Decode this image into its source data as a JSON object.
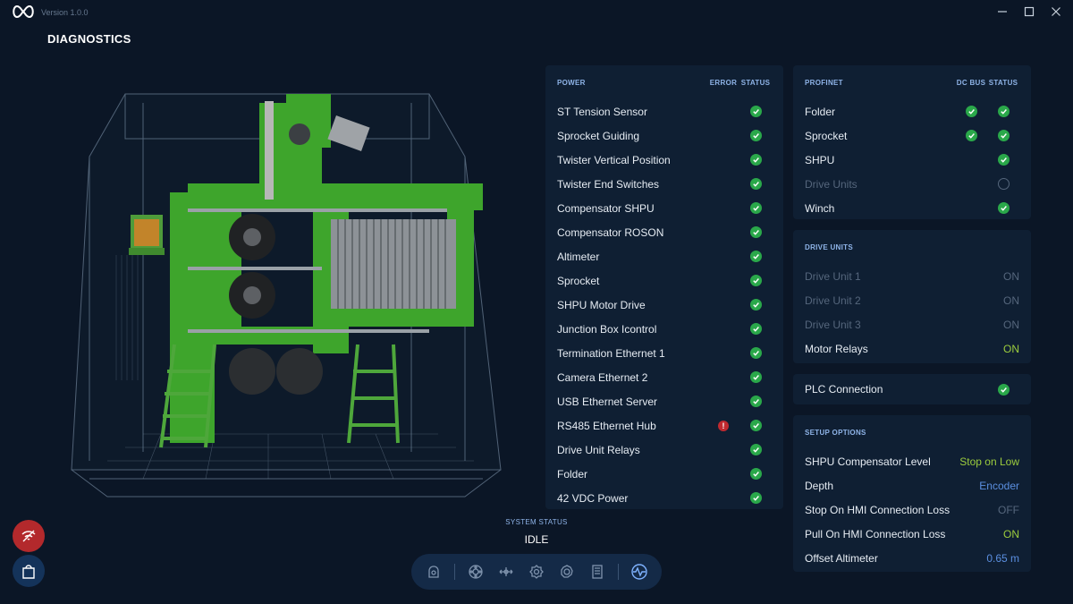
{
  "app": {
    "version": "Version 1.0.0"
  },
  "page": {
    "title": "DIAGNOSTICS"
  },
  "power": {
    "title": "POWER",
    "col_error": "ERROR",
    "col_status": "STATUS",
    "rows": [
      {
        "label": "ST Tension Sensor",
        "error": false,
        "status": "ok"
      },
      {
        "label": "Sprocket Guiding",
        "error": false,
        "status": "ok"
      },
      {
        "label": "Twister Vertical Position",
        "error": false,
        "status": "ok"
      },
      {
        "label": "Twister End Switches",
        "error": false,
        "status": "ok"
      },
      {
        "label": "Compensator SHPU",
        "error": false,
        "status": "ok"
      },
      {
        "label": "Compensator ROSON",
        "error": false,
        "status": "ok"
      },
      {
        "label": "Altimeter",
        "error": false,
        "status": "ok"
      },
      {
        "label": "Sprocket",
        "error": false,
        "status": "ok"
      },
      {
        "label": "SHPU Motor Drive",
        "error": false,
        "status": "ok"
      },
      {
        "label": "Junction Box Icontrol",
        "error": false,
        "status": "ok"
      },
      {
        "label": "Termination Ethernet 1",
        "error": false,
        "status": "ok"
      },
      {
        "label": "Camera Ethernet 2",
        "error": false,
        "status": "ok"
      },
      {
        "label": "USB Ethernet Server",
        "error": false,
        "status": "ok"
      },
      {
        "label": "RS485 Ethernet Hub",
        "error": true,
        "status": "ok"
      },
      {
        "label": "Drive Unit Relays",
        "error": false,
        "status": "ok"
      },
      {
        "label": "Folder",
        "error": false,
        "status": "ok"
      },
      {
        "label": "42 VDC Power",
        "error": false,
        "status": "ok"
      }
    ]
  },
  "profinet": {
    "title": "PROFINET",
    "col_dcbus": "DC BUS",
    "col_status": "STATUS",
    "rows": [
      {
        "label": "Folder",
        "dcbus": "ok",
        "status": "ok",
        "disabled": false
      },
      {
        "label": "Sprocket",
        "dcbus": "ok",
        "status": "ok",
        "disabled": false
      },
      {
        "label": "SHPU",
        "dcbus": "none",
        "status": "ok",
        "disabled": false
      },
      {
        "label": "Drive Units",
        "dcbus": "none",
        "status": "empty",
        "disabled": true
      },
      {
        "label": "Winch",
        "dcbus": "none",
        "status": "ok",
        "disabled": false
      }
    ]
  },
  "drive_units": {
    "title": "DRIVE UNITS",
    "rows": [
      {
        "label": "Drive Unit 1",
        "value": "ON",
        "color": "#55667c",
        "disabled": true
      },
      {
        "label": "Drive Unit 2",
        "value": "ON",
        "color": "#55667c",
        "disabled": true
      },
      {
        "label": "Drive Unit 3",
        "value": "ON",
        "color": "#55667c",
        "disabled": true
      },
      {
        "label": "Motor Relays",
        "value": "ON",
        "color": "#9ccc3d",
        "disabled": false
      }
    ]
  },
  "plc": {
    "label": "PLC Connection",
    "status": "ok"
  },
  "setup": {
    "title": "SETUP OPTIONS",
    "rows": [
      {
        "label": "SHPU Compensator Level",
        "value": "Stop on Low",
        "color": "#9ccc3d"
      },
      {
        "label": "Depth",
        "value": "Encoder",
        "color": "#5b8fe0"
      },
      {
        "label": "Stop On HMI Connection Loss",
        "value": "OFF",
        "color": "#55667c"
      },
      {
        "label": "Pull On HMI Connection Loss",
        "value": "ON",
        "color": "#9ccc3d"
      },
      {
        "label": "Offset Altimeter",
        "value": "0.65 m",
        "color": "#5b8fe0"
      }
    ]
  },
  "system_status": {
    "label": "SYSTEM STATUS",
    "value": "IDLE"
  },
  "nav": {
    "icons": [
      "camera-icon",
      "reel-icon",
      "move-icon",
      "settings-icon",
      "gear-cog-icon",
      "document-icon",
      "diagnostics-icon"
    ],
    "active": "diagnostics-icon"
  },
  "colors": {
    "accent": "#5b8fe0",
    "ok": "#2aa84a",
    "error": "#c0292f",
    "on": "#9ccc3d"
  }
}
